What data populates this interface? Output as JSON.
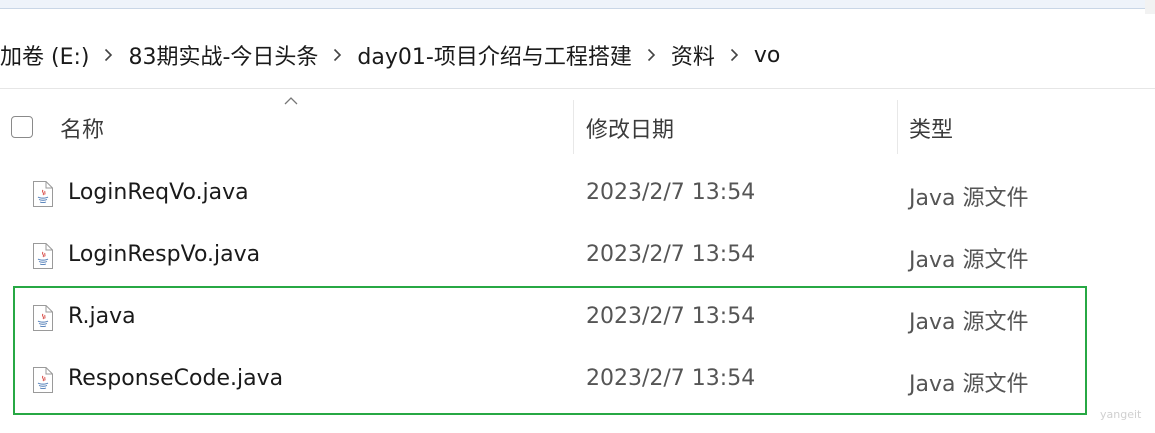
{
  "breadcrumb": {
    "items": [
      "加卷 (E:)",
      "83期实战-今日头条",
      "day01-项目介绍与工程搭建",
      "资料",
      "vo"
    ]
  },
  "columns": {
    "name": "名称",
    "date": "修改日期",
    "type": "类型"
  },
  "files": [
    {
      "name": "LoginReqVo.java",
      "date": "2023/2/7 13:54",
      "type": "Java 源文件"
    },
    {
      "name": "LoginRespVo.java",
      "date": "2023/2/7 13:54",
      "type": "Java 源文件"
    },
    {
      "name": "R.java",
      "date": "2023/2/7 13:54",
      "type": "Java 源文件"
    },
    {
      "name": "ResponseCode.java",
      "date": "2023/2/7 13:54",
      "type": "Java 源文件"
    }
  ],
  "watermark": "yangeit",
  "colors": {
    "highlight": "#27a844",
    "header_text": "#3b3b3b",
    "secondary_text": "#555555"
  }
}
